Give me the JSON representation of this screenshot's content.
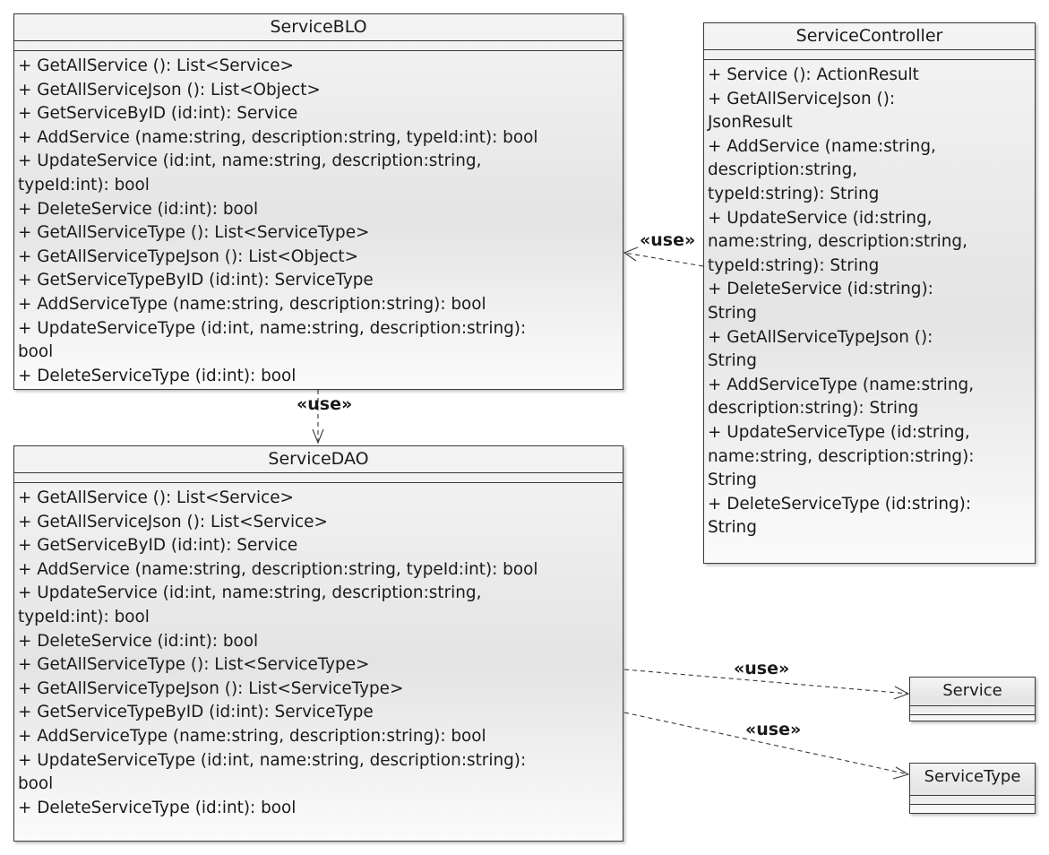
{
  "classes": {
    "blo": {
      "name": "ServiceBLO",
      "operations": [
        "+ GetAllService (): List<Service>",
        "+ GetAllServiceJson (): List<Object>",
        "+ GetServiceByID (id:int): Service",
        "+ AddService (name:string, description:string, typeId:int): bool",
        "+ UpdateService (id:int, name:string, description:string,\ntypeId:int): bool",
        "+ DeleteService (id:int): bool",
        "+ GetAllServiceType (): List<ServiceType>",
        "+ GetAllServiceTypeJson (): List<Object>",
        "+ GetServiceTypeByID (id:int): ServiceType",
        "+ AddServiceType (name:string, description:string): bool",
        "+ UpdateServiceType (id:int, name:string, description:string):\nbool",
        "+ DeleteServiceType (id:int): bool"
      ]
    },
    "controller": {
      "name": "ServiceController",
      "operations": [
        "+ Service (): ActionResult",
        "+ GetAllServiceJson ():\nJsonResult",
        "+ AddService (name:string,\ndescription:string,\ntypeId:string): String",
        "+ UpdateService (id:string,\nname:string, description:string,\ntypeId:string): String",
        "+ DeleteService (id:string):\nString",
        "+ GetAllServiceTypeJson ():\nString",
        "+ AddServiceType (name:string,\ndescription:string): String",
        "+ UpdateServiceType (id:string,\nname:string, description:string):\nString",
        "+ DeleteServiceType (id:string):\nString"
      ]
    },
    "dao": {
      "name": "ServiceDAO",
      "operations": [
        "+ GetAllService (): List<Service>",
        "+ GetAllServiceJson (): List<Service>",
        "+ GetServiceByID (id:int): Service",
        "+ AddService (name:string, description:string, typeId:int): bool",
        "+ UpdateService (id:int, name:string, description:string,\ntypeId:int): bool",
        "+ DeleteService (id:int): bool",
        "+ GetAllServiceType (): List<ServiceType>",
        "+ GetAllServiceTypeJson (): List<ServiceType>",
        "+ GetServiceTypeByID (id:int): ServiceType",
        "+ AddServiceType (name:string, description:string): bool",
        "+ UpdateServiceType (id:int, name:string, description:string):\nbool",
        "+ DeleteServiceType (id:int): bool"
      ]
    },
    "service": {
      "name": "Service"
    },
    "servicetype": {
      "name": "ServiceType"
    }
  },
  "relations": {
    "controller_blo": "«use»",
    "blo_dao": "«use»",
    "dao_service": "«use»",
    "dao_servicetype": "«use»"
  }
}
